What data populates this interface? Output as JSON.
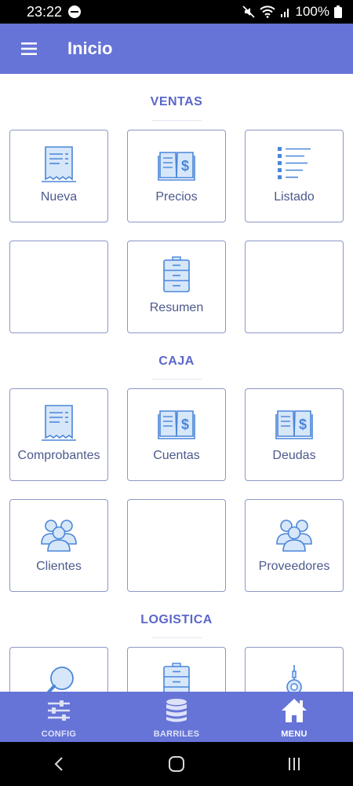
{
  "status": {
    "time": "23:22",
    "battery": "100%",
    "icons": [
      "do-not-disturb-icon",
      "mute-icon",
      "wifi-icon",
      "signal-icon",
      "battery-icon"
    ]
  },
  "app_bar": {
    "title": "Inicio",
    "menu_icon": "hamburger-menu-icon"
  },
  "sections": {
    "ventas": "VENTAS",
    "caja": "CAJA",
    "logistica": "LOGISTICA"
  },
  "tiles": {
    "nueva": "Nueva",
    "precios": "Precios",
    "listado": "Listado",
    "resumen": "Resumen",
    "comprobantes": "Comprobantes",
    "cuentas": "Cuentas",
    "deudas": "Deudas",
    "clientes": "Clientes",
    "proveedores": "Proveedores"
  },
  "bottom_nav": {
    "config": "CONFIG",
    "barriles": "BARRILES",
    "menu": "MENU"
  },
  "colors": {
    "primary": "#6674d8",
    "section_title": "#5b67c9",
    "tile_border": "#8c98c9",
    "icon_blue": "#4a86d9",
    "nav_inactive": "#dde2f8",
    "nav_active": "#ffffff"
  }
}
